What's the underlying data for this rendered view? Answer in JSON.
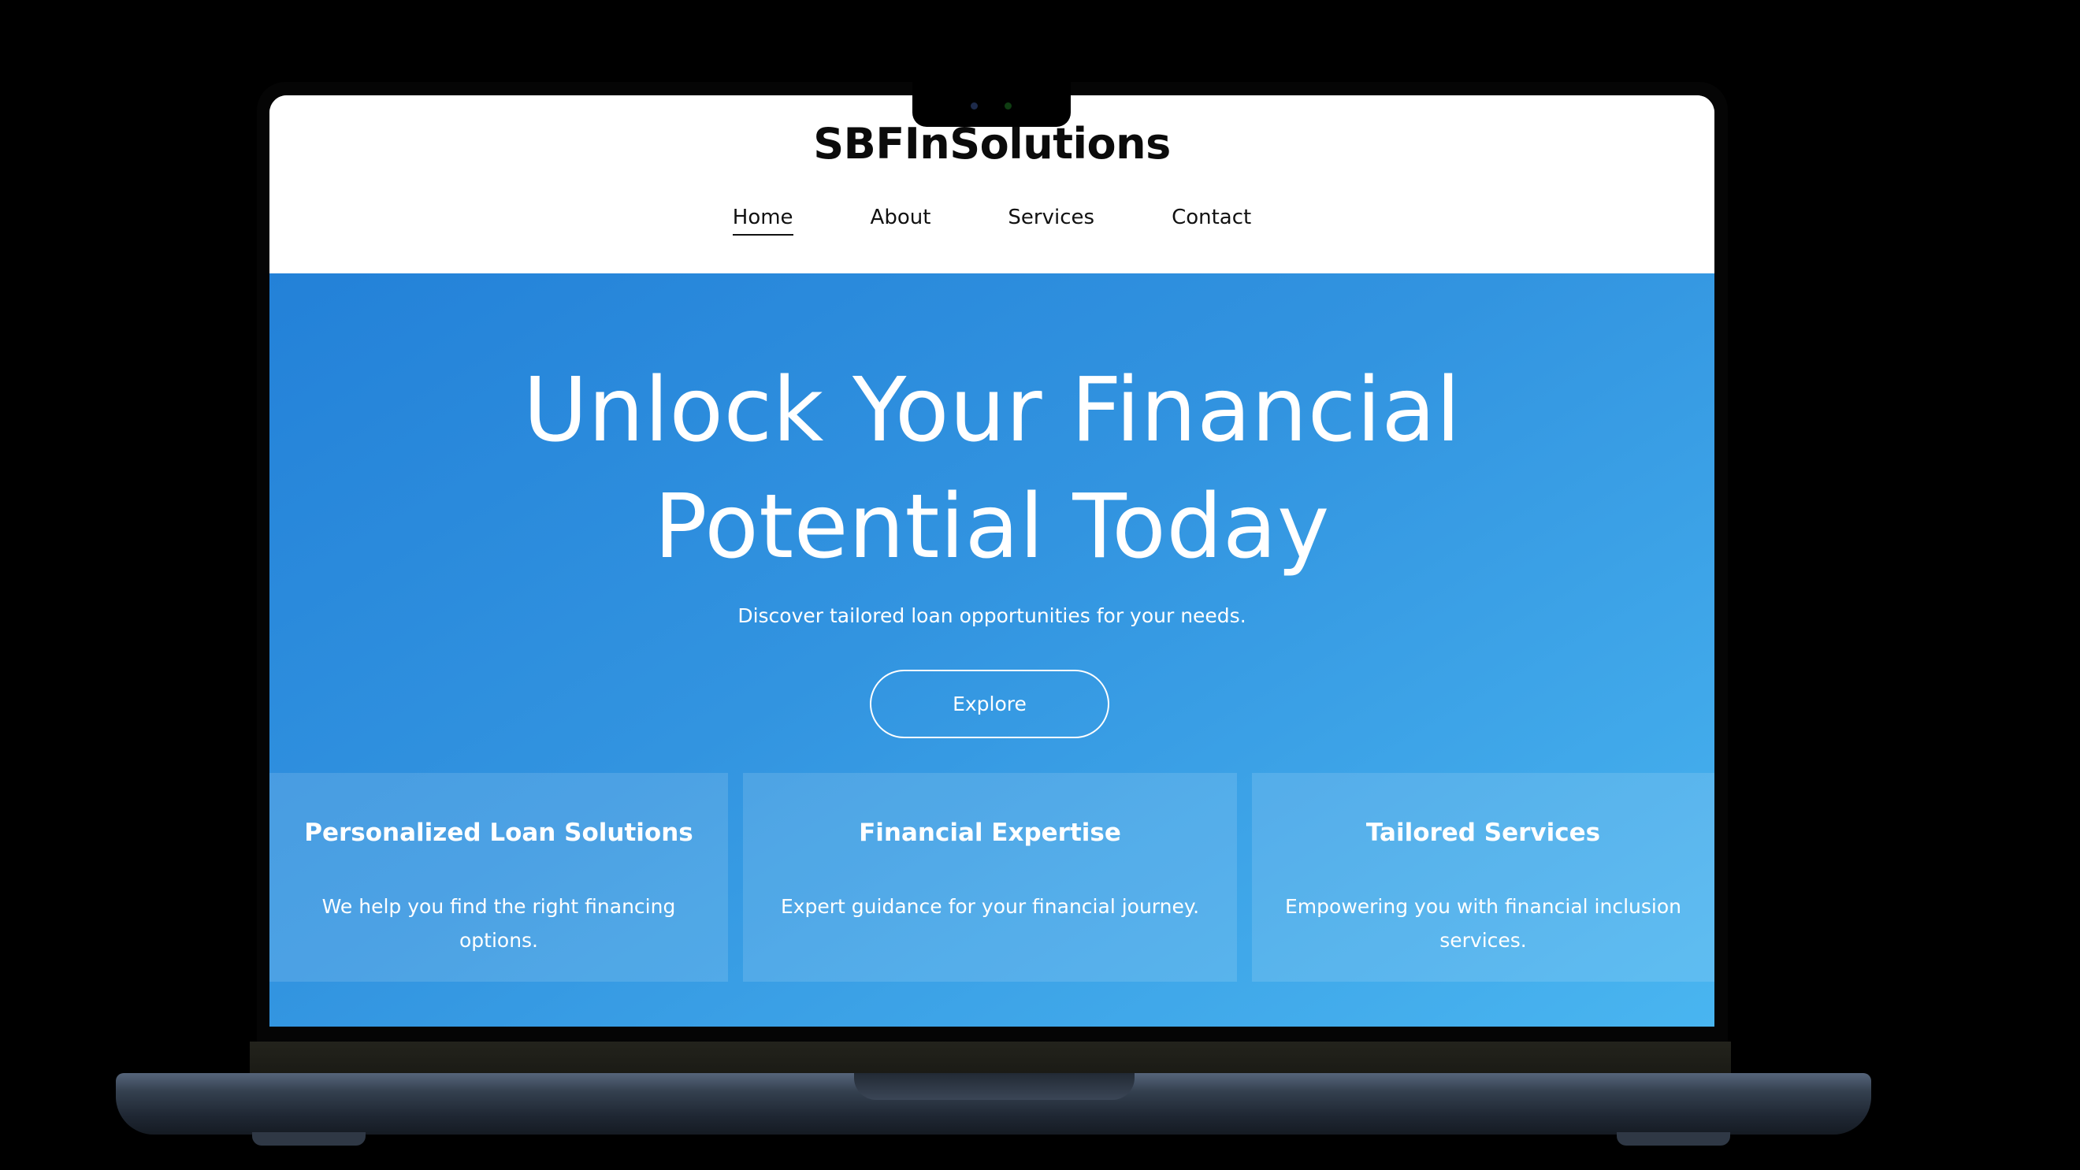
{
  "site": {
    "brand": "SBFInSolutions",
    "nav": [
      {
        "label": "Home",
        "active": true
      },
      {
        "label": "About",
        "active": false
      },
      {
        "label": "Services",
        "active": false
      },
      {
        "label": "Contact",
        "active": false
      }
    ]
  },
  "hero": {
    "title_line1": "Unlock Your Financial",
    "title_line2": "Potential Today",
    "subtitle": "Discover tailored loan opportunities for your needs.",
    "button_label": "Explore"
  },
  "features": [
    {
      "title": "Personalized Loan Solutions",
      "description": "We help you find the right financing options."
    },
    {
      "title": "Financial Expertise",
      "description": "Expert guidance for your financial journey."
    },
    {
      "title": "Tailored Services",
      "description": "Empowering you with financial inclusion services."
    }
  ],
  "colors": {
    "hero_gradient_start": "#2381d8",
    "hero_gradient_end": "#49b5f0",
    "header_bg": "#ffffff",
    "brand_text": "#0b0b0b",
    "laptop_body": "#1f2733"
  }
}
